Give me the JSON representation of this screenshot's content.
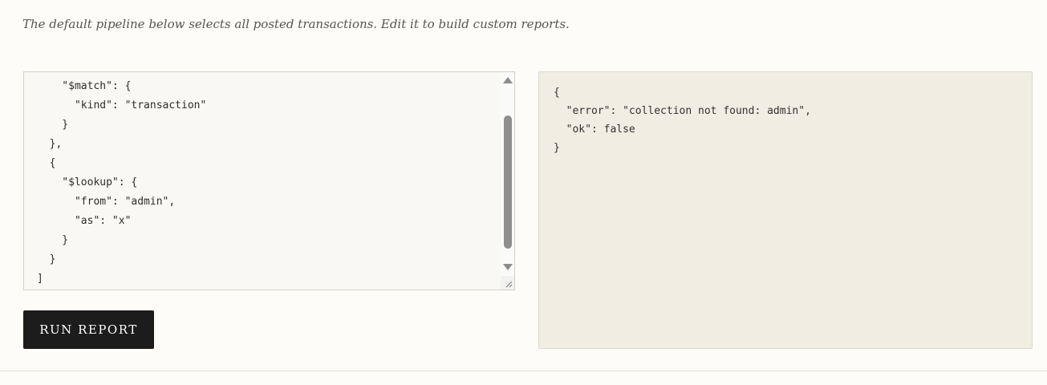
{
  "intro_text": "The default pipeline below selects all posted transactions. Edit it to build custom reports.",
  "editor": {
    "code": "  [\n    \"$match\": {\n      \"kind\": \"transaction\"\n    }\n  },\n  {\n    \"$lookup\": {\n      \"from\": \"admin\",\n      \"as\": \"x\"\n    }\n  }\n]"
  },
  "run_button_label": "RUN REPORT",
  "output": {
    "text": "{\n  \"error\": \"collection not found: admin\",\n  \"ok\": false\n}"
  }
}
